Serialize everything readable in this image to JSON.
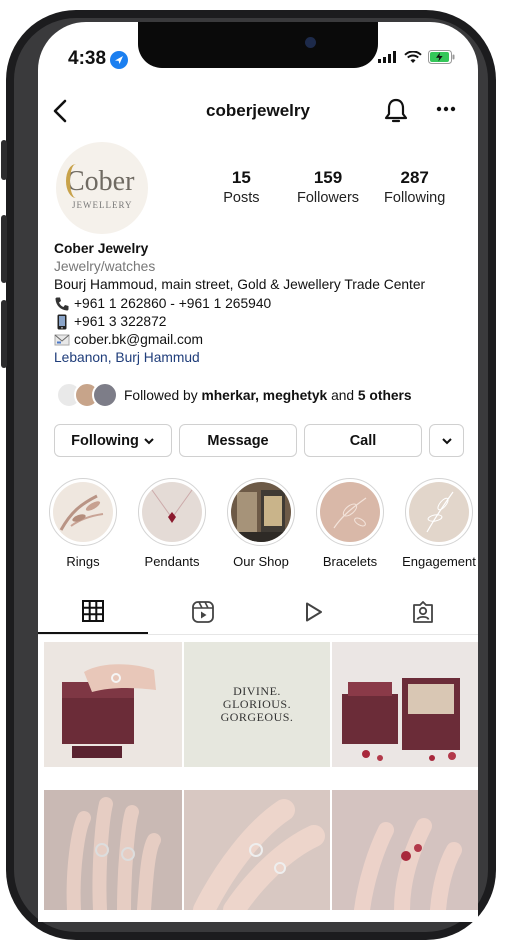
{
  "status_bar": {
    "time": "4:38"
  },
  "header": {
    "username": "coberjewelry"
  },
  "profile": {
    "avatar_text": "Cober",
    "avatar_subtext": "JEWELLERY",
    "stats": [
      {
        "value": "15",
        "label": "Posts"
      },
      {
        "value": "159",
        "label": "Followers"
      },
      {
        "value": "287",
        "label": "Following"
      }
    ]
  },
  "bio": {
    "name": "Cober Jewelry",
    "category": "Jewelry/watches",
    "address": "Bourj Hammoud, main street, Gold & Jewellery Trade Center",
    "phone1": "+961 1 262860 - +961 1 265940",
    "phone2": "+961 3 322872",
    "email": "cober.bk@gmail.com",
    "location": "Lebanon, Burj Hammud"
  },
  "followed_by": {
    "prefix": "Followed by ",
    "names": "mherkar, meghetyk",
    "middle": " and ",
    "others": "5 others"
  },
  "actions": {
    "following": "Following",
    "message": "Message",
    "call": "Call"
  },
  "highlights": [
    {
      "label": "Rings"
    },
    {
      "label": "Pendants"
    },
    {
      "label": "Our Shop"
    },
    {
      "label": "Bracelets"
    },
    {
      "label": "Engagement"
    }
  ],
  "posts": {
    "post2_line1": "DIVINE.",
    "post2_line2": "GLORIOUS.",
    "post2_line3": "GORGEOUS."
  },
  "colors": {
    "text": "#111111",
    "secondary": "#777777",
    "link": "#1f3d7a",
    "border": "#d0d0d0",
    "location_blue": "#1b7ff0"
  },
  "icons": [
    "back-arrow-icon",
    "bell-icon",
    "more-icon",
    "phone-icon",
    "mobile-icon",
    "email-icon",
    "chevron-down-icon",
    "grid-icon",
    "reels-icon",
    "play-icon",
    "tagged-icon"
  ]
}
